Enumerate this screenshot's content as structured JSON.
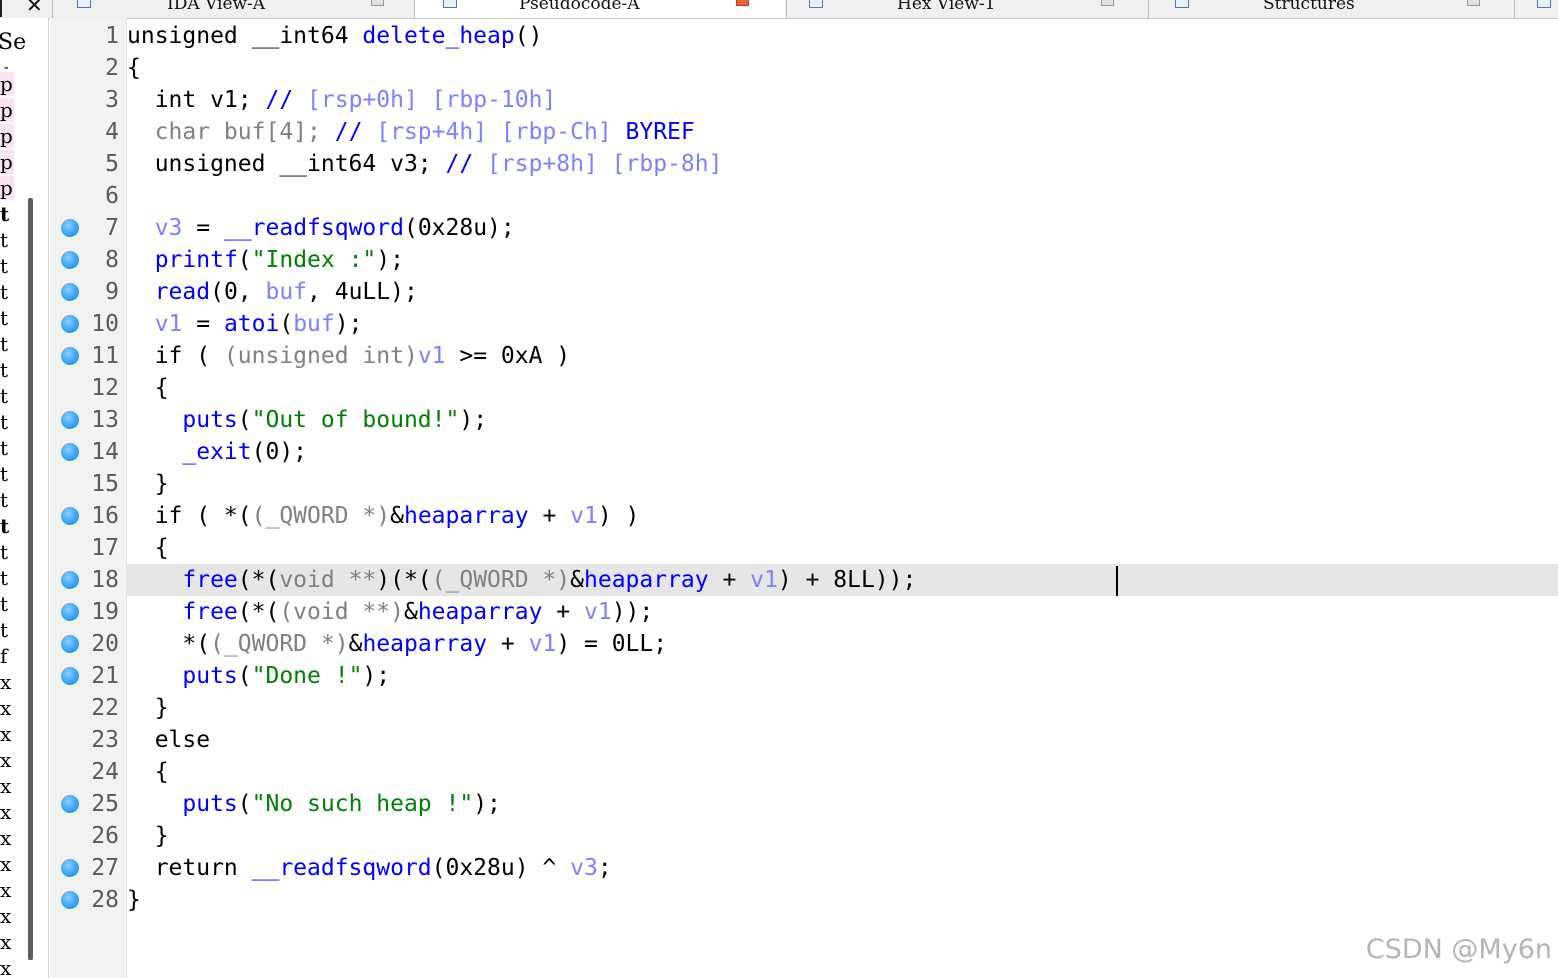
{
  "tabs": [
    {
      "label": "IDA View-A",
      "active": false
    },
    {
      "label": "Pseudocode-A",
      "active": true
    },
    {
      "label": "Hex View-1",
      "active": false
    },
    {
      "label": "Structures",
      "active": false
    }
  ],
  "side_panel": {
    "header": "Se",
    "rows": [
      "p",
      "p",
      "p",
      "p",
      "p",
      "t",
      "t",
      "t",
      "t",
      "t",
      "t",
      "t",
      "t",
      "t",
      "t",
      "t",
      "t",
      "t",
      "t",
      "t",
      "t",
      "t",
      "f",
      "x",
      "x",
      "x",
      "x",
      "x",
      "x",
      "x",
      "x",
      "x",
      "x",
      "x",
      "x"
    ]
  },
  "editor": {
    "line_numbers": [
      "1",
      "2",
      "3",
      "4",
      "5",
      "6",
      "7",
      "8",
      "9",
      "10",
      "11",
      "12",
      "13",
      "14",
      "15",
      "16",
      "17",
      "18",
      "19",
      "20",
      "21",
      "22",
      "23",
      "24",
      "25",
      "26",
      "27",
      "28"
    ],
    "breakpoint_lines": [
      "7",
      "8",
      "9",
      "10",
      "11",
      "13",
      "14",
      "16",
      "18",
      "19",
      "20",
      "21",
      "25",
      "27",
      "28"
    ],
    "highlighted_line": "18",
    "lines": [
      [
        [
          "kw",
          "unsigned __int64 "
        ],
        [
          "fn",
          "delete_heap"
        ],
        [
          "kw",
          "()"
        ]
      ],
      [
        [
          "kw",
          "{"
        ]
      ],
      [
        [
          "kw",
          "  int v1; "
        ],
        [
          "cm",
          "// "
        ],
        [
          "cmv",
          "[rsp+0h] [rbp-10h]"
        ]
      ],
      [
        [
          "cast",
          "  char buf[4]; "
        ],
        [
          "cm",
          "// "
        ],
        [
          "cmv",
          "[rsp+4h] [rbp-Ch] "
        ],
        [
          "cm",
          "BYREF"
        ]
      ],
      [
        [
          "kw",
          "  unsigned __int64 v3; "
        ],
        [
          "cm",
          "// "
        ],
        [
          "cmv",
          "[rsp+8h] [rbp-8h]"
        ]
      ],
      [
        [
          "kw",
          ""
        ]
      ],
      [
        [
          "kw",
          "  "
        ],
        [
          "var",
          "v3"
        ],
        [
          "kw",
          " = "
        ],
        [
          "fn",
          "__readfsqword"
        ],
        [
          "kw",
          "(0x28u);"
        ]
      ],
      [
        [
          "kw",
          "  "
        ],
        [
          "fn",
          "printf"
        ],
        [
          "kw",
          "("
        ],
        [
          "str",
          "\"Index :\""
        ],
        [
          "kw",
          ");"
        ]
      ],
      [
        [
          "kw",
          "  "
        ],
        [
          "fn",
          "read"
        ],
        [
          "kw",
          "(0, "
        ],
        [
          "var",
          "buf"
        ],
        [
          "kw",
          ", 4uLL);"
        ]
      ],
      [
        [
          "kw",
          "  "
        ],
        [
          "var",
          "v1"
        ],
        [
          "kw",
          " = "
        ],
        [
          "fn",
          "atoi"
        ],
        [
          "kw",
          "("
        ],
        [
          "var",
          "buf"
        ],
        [
          "kw",
          ");"
        ]
      ],
      [
        [
          "kw",
          "  if ( "
        ],
        [
          "cast",
          "(unsigned int)"
        ],
        [
          "var",
          "v1"
        ],
        [
          "kw",
          " >= 0xA )"
        ]
      ],
      [
        [
          "kw",
          "  {"
        ]
      ],
      [
        [
          "kw",
          "    "
        ],
        [
          "fn",
          "puts"
        ],
        [
          "kw",
          "("
        ],
        [
          "str",
          "\"Out of bound!\""
        ],
        [
          "kw",
          ");"
        ]
      ],
      [
        [
          "kw",
          "    "
        ],
        [
          "fn",
          "_exit"
        ],
        [
          "kw",
          "(0);"
        ]
      ],
      [
        [
          "kw",
          "  }"
        ]
      ],
      [
        [
          "kw",
          "  if ( *("
        ],
        [
          "cast",
          "(_QWORD *)"
        ],
        [
          "kw",
          "&"
        ],
        [
          "fn",
          "heaparray"
        ],
        [
          "kw",
          " + "
        ],
        [
          "var",
          "v1"
        ],
        [
          "kw",
          ") )"
        ]
      ],
      [
        [
          "kw",
          "  {"
        ]
      ],
      [
        [
          "kw",
          "    "
        ],
        [
          "fn",
          "free"
        ],
        [
          "kw",
          "(*("
        ],
        [
          "cast",
          "void **"
        ],
        [
          "kw",
          ")(*("
        ],
        [
          "cast",
          "(_QWORD *)"
        ],
        [
          "kw",
          "&"
        ],
        [
          "fn",
          "heaparray"
        ],
        [
          "kw",
          " + "
        ],
        [
          "var",
          "v1"
        ],
        [
          "kw",
          ") + 8LL));"
        ]
      ],
      [
        [
          "kw",
          "    "
        ],
        [
          "fn",
          "free"
        ],
        [
          "kw",
          "(*("
        ],
        [
          "cast",
          "(void **)"
        ],
        [
          "kw",
          "&"
        ],
        [
          "fn",
          "heaparray"
        ],
        [
          "kw",
          " + "
        ],
        [
          "var",
          "v1"
        ],
        [
          "kw",
          "));"
        ]
      ],
      [
        [
          "kw",
          "    *("
        ],
        [
          "cast",
          "(_QWORD *)"
        ],
        [
          "kw",
          "&"
        ],
        [
          "fn",
          "heaparray"
        ],
        [
          "kw",
          " + "
        ],
        [
          "var",
          "v1"
        ],
        [
          "kw",
          ") = 0LL;"
        ]
      ],
      [
        [
          "kw",
          "    "
        ],
        [
          "fn",
          "puts"
        ],
        [
          "kw",
          "("
        ],
        [
          "str",
          "\"Done !\""
        ],
        [
          "kw",
          ");"
        ]
      ],
      [
        [
          "kw",
          "  }"
        ]
      ],
      [
        [
          "kw",
          "  else"
        ]
      ],
      [
        [
          "kw",
          "  {"
        ]
      ],
      [
        [
          "kw",
          "    "
        ],
        [
          "fn",
          "puts"
        ],
        [
          "kw",
          "("
        ],
        [
          "str",
          "\"No such heap !\""
        ],
        [
          "kw",
          ");"
        ]
      ],
      [
        [
          "kw",
          "  }"
        ]
      ],
      [
        [
          "kw",
          "  return "
        ],
        [
          "fn",
          "__readfsqword"
        ],
        [
          "kw",
          "(0x28u) ^ "
        ],
        [
          "var",
          "v3"
        ],
        [
          "kw",
          ";"
        ]
      ],
      [
        [
          "kw",
          "}"
        ]
      ]
    ]
  },
  "watermark": "CSDN @My6n",
  "colors": {
    "function": "#0000ff",
    "string": "#008000",
    "variable": "#8080ff",
    "cast": "#808080",
    "highlight": "#e6e6e6",
    "breakpoint": "#37a5f2"
  }
}
